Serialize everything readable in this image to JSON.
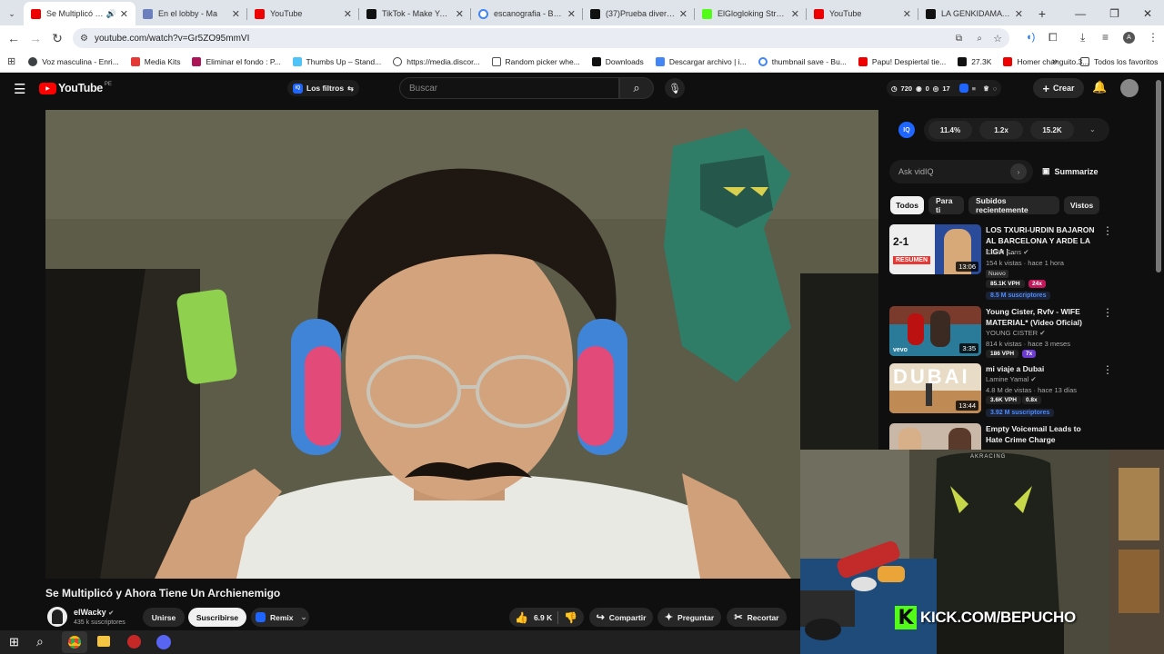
{
  "browser": {
    "tabs": [
      {
        "label": "Se Multiplicó y A",
        "icon": "youtube-icon",
        "active": true
      },
      {
        "label": "En el lobby - Ma",
        "icon": "lobby-icon"
      },
      {
        "label": "YouTube",
        "icon": "youtube-icon"
      },
      {
        "label": "TikTok - Make Your D",
        "icon": "tiktok-icon"
      },
      {
        "label": "escanografia - Busca",
        "icon": "google-icon"
      },
      {
        "label": "(37)Prueba divertida",
        "icon": "tiktok-icon"
      },
      {
        "label": "ElGlogloking Stream",
        "icon": "kick-icon"
      },
      {
        "label": "YouTube",
        "icon": "youtube-icon"
      },
      {
        "label": "LA GENKIDAMA ERE",
        "icon": "tiktok-icon"
      }
    ],
    "url": "youtube.com/watch?v=Gr5ZO95mmVI",
    "bookmarks": [
      {
        "label": "Voz masculina - Enri...",
        "color": "#3c4043"
      },
      {
        "label": "Media Kits",
        "color": "#e53935"
      },
      {
        "label": "Eliminar el fondo : P...",
        "color": "#ad1457"
      },
      {
        "label": "Thumbs Up – Stand...",
        "color": "#4fc3f7"
      },
      {
        "label": "https://media.discor...",
        "color": "#444"
      },
      {
        "label": "Random picker whe...",
        "color": "#555"
      },
      {
        "label": "Downloads",
        "color": "#111"
      },
      {
        "label": "Descargar archivo | i...",
        "color": "#4285f4"
      },
      {
        "label": "thumbnail save - Bu...",
        "color": "#4285f4"
      },
      {
        "label": "Papu! Despiertal tie...",
        "color": "#e00"
      },
      {
        "label": "27.3K",
        "color": "#111"
      },
      {
        "label": "Homer changuito.3...",
        "color": "#e00"
      }
    ],
    "all_favorites": "Todos los favoritos"
  },
  "youtube": {
    "logo": "YouTube",
    "region": "PE",
    "filters_label": "Los filtros",
    "search_placeholder": "Buscar",
    "stats": {
      "views": "720",
      "a": "0",
      "b": "17"
    },
    "create_label": "Crear"
  },
  "vidiq": {
    "badge": "IQ",
    "stats": [
      "11.4%",
      "1.2x",
      "15.2K"
    ],
    "ask_placeholder": "Ask vidIQ",
    "summarize_label": "Summarize"
  },
  "chips": [
    "Todos",
    "Para ti",
    "Subidos recientemente",
    "Vistos"
  ],
  "recommendations": [
    {
      "title": "LOS TXURI-URDIN BAJARON AL BARCELONA Y ARDE LA LIGA |...",
      "channel": "ESPN Fans",
      "meta": "154 k vistas · hace 1 hora",
      "badge": "Nuevo",
      "duration": "13:06",
      "vph": "85.1K VPH",
      "multiplier": "24x",
      "subs": "8.5 M suscriptores",
      "thumb_text": "RESUMEN"
    },
    {
      "title": "Young Cister, Rvfv - WIFE MATERIAL* (Video Oficial)",
      "channel": "YOUNG CISTER",
      "meta": "814 k vistas · hace 3 meses",
      "duration": "3:35",
      "vph": "186 VPH",
      "multiplier": "7x",
      "thumb_text": "vevo"
    },
    {
      "title": "mi viaje a Dubai",
      "channel": "Lamine Yamal",
      "meta": "4.8 M de vistas · hace 13 días",
      "duration": "13:44",
      "vph": "3.6K VPH",
      "multiplier": "0.8x",
      "subs": "3.92 M suscriptores",
      "thumb_text": "DUBAI"
    },
    {
      "title": "Empty Voicemail Leads to Hate Crime Charge"
    }
  ],
  "video": {
    "title": "Se Multiplicó y Ahora Tiene Un Archienemigo",
    "channel": "elWacky",
    "subscribers": "435 k suscriptores",
    "join_label": "Unirse",
    "subscribe_label": "Suscribirse",
    "remix_label": "Remix",
    "likes": "6.9 K",
    "share_label": "Compartir",
    "ask_label": "Preguntar",
    "clip_label": "Recortar"
  },
  "overlay": {
    "kick_url": "KICK.COM/BEPUCHO",
    "chair_brand": "AKRACING"
  }
}
